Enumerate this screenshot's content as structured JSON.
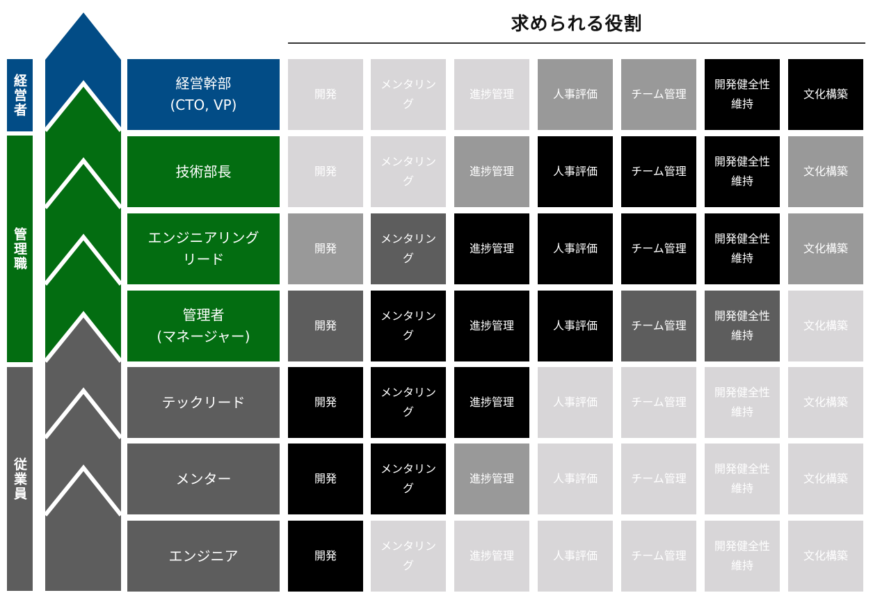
{
  "title": "求められる役割",
  "colors": {
    "executive": "#024c86",
    "management": "#036d11",
    "employee": "#5d5d5d",
    "levels": [
      "#d8d6d8",
      "#999999",
      "#5d5d5d",
      "#000000"
    ]
  },
  "groups": [
    {
      "label": "経営者",
      "color": "#024c86",
      "rows": [
        0
      ]
    },
    {
      "label": "管理職",
      "color": "#036d11",
      "rows": [
        1,
        2,
        3
      ]
    },
    {
      "label": "従業員",
      "color": "#5d5d5d",
      "rows": [
        4,
        5,
        6
      ]
    }
  ],
  "columns": [
    "開発",
    "メンタリング",
    "進捗管理",
    "人事評価",
    "チーム管理",
    "開発健全性維持",
    "文化構築"
  ],
  "rows": [
    {
      "role": "経営幹部\n(CTO, VP)",
      "group": "executive",
      "cells": [
        {
          "t": "開発",
          "lv": 0
        },
        {
          "t": "メンタリン\nグ",
          "lv": 0
        },
        {
          "t": "進捗管理",
          "lv": 0
        },
        {
          "t": "人事評価",
          "lv": 1
        },
        {
          "t": "チーム管理",
          "lv": 1
        },
        {
          "t": "開発健全性\n維持",
          "lv": 3
        },
        {
          "t": "文化構築",
          "lv": 3
        }
      ]
    },
    {
      "role": "技術部長",
      "group": "management",
      "cells": [
        {
          "t": "開発",
          "lv": 0
        },
        {
          "t": "メンタリン\nグ",
          "lv": 0
        },
        {
          "t": "進捗管理",
          "lv": 1
        },
        {
          "t": "人事評価",
          "lv": 3
        },
        {
          "t": "チーム管理",
          "lv": 3
        },
        {
          "t": "開発健全性\n維持",
          "lv": 3
        },
        {
          "t": "文化構築",
          "lv": 1
        }
      ]
    },
    {
      "role": "エンジニアリング\nリード",
      "group": "management",
      "cells": [
        {
          "t": "開発",
          "lv": 1
        },
        {
          "t": "メンタリン\nグ",
          "lv": 2
        },
        {
          "t": "進捗管理",
          "lv": 3
        },
        {
          "t": "人事評価",
          "lv": 3
        },
        {
          "t": "チーム管理",
          "lv": 3
        },
        {
          "t": "開発健全性\n維持",
          "lv": 3
        },
        {
          "t": "文化構築",
          "lv": 1
        }
      ]
    },
    {
      "role": "管理者\n(マネージャー)",
      "group": "management",
      "cells": [
        {
          "t": "開発",
          "lv": 2
        },
        {
          "t": "メンタリン\nグ",
          "lv": 3
        },
        {
          "t": "進捗管理",
          "lv": 3
        },
        {
          "t": "人事評価",
          "lv": 3
        },
        {
          "t": "チーム管理",
          "lv": 2
        },
        {
          "t": "開発健全性\n維持",
          "lv": 2
        },
        {
          "t": "文化構築",
          "lv": 0
        }
      ]
    },
    {
      "role": "テックリード",
      "group": "employee",
      "cells": [
        {
          "t": "開発",
          "lv": 3
        },
        {
          "t": "メンタリン\nグ",
          "lv": 3
        },
        {
          "t": "進捗管理",
          "lv": 3
        },
        {
          "t": "人事評価",
          "lv": 0
        },
        {
          "t": "チーム管理",
          "lv": 0
        },
        {
          "t": "開発健全性\n維持",
          "lv": 0
        },
        {
          "t": "文化構築",
          "lv": 0
        }
      ]
    },
    {
      "role": "メンター",
      "group": "employee",
      "cells": [
        {
          "t": "開発",
          "lv": 3
        },
        {
          "t": "メンタリン\nグ",
          "lv": 3
        },
        {
          "t": "進捗管理",
          "lv": 1
        },
        {
          "t": "人事評価",
          "lv": 0
        },
        {
          "t": "チーム管理",
          "lv": 0
        },
        {
          "t": "開発健全性\n維持",
          "lv": 0
        },
        {
          "t": "文化構築",
          "lv": 0
        }
      ]
    },
    {
      "role": "エンジニア",
      "group": "employee",
      "cells": [
        {
          "t": "開発",
          "lv": 3
        },
        {
          "t": "メンタリン\nグ",
          "lv": 0
        },
        {
          "t": "進捗管理",
          "lv": 0
        },
        {
          "t": "人事評価",
          "lv": 0
        },
        {
          "t": "チーム管理",
          "lv": 0
        },
        {
          "t": "開発健全性\n維持",
          "lv": 0
        },
        {
          "t": "文化構築",
          "lv": 0
        }
      ]
    }
  ]
}
